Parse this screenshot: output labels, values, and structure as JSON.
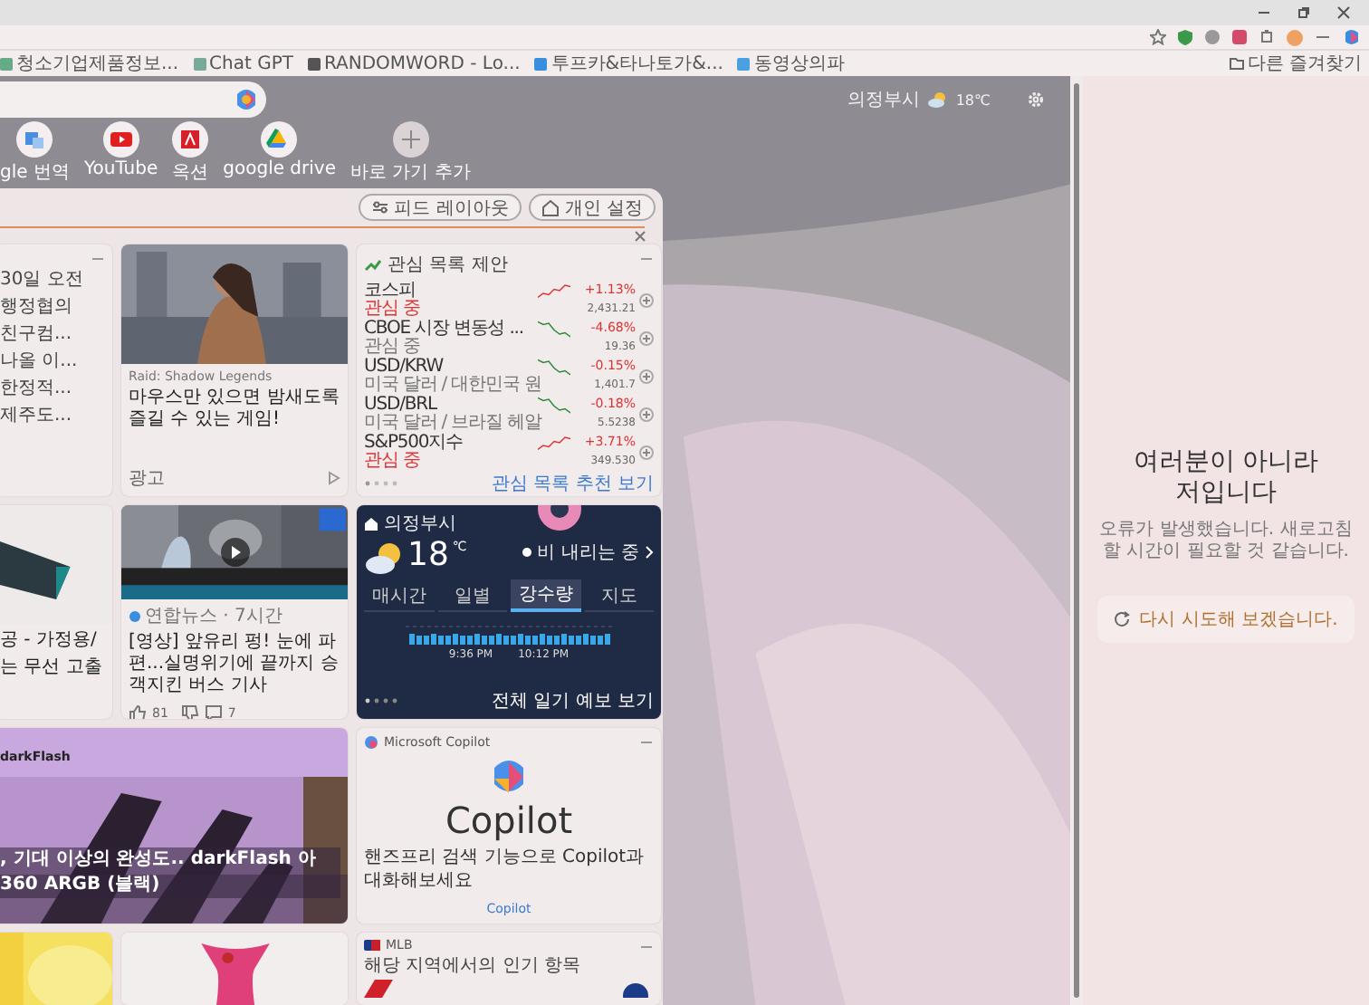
{
  "bookmarks": [
    {
      "label": "청소기업제품정보..."
    },
    {
      "label": "Chat GPT"
    },
    {
      "label": "RANDOMWORD - Lo..."
    },
    {
      "label": "투프카&타나토가&..."
    },
    {
      "label": "동영상의파"
    }
  ],
  "other_favorites": "다른 즐겨찾기",
  "header_weather": {
    "location": "의정부시",
    "temp": "18℃"
  },
  "quick_links": [
    {
      "label": "gle 번역",
      "kind": "translate"
    },
    {
      "label": "YouTube",
      "kind": "youtube"
    },
    {
      "label": "옥션",
      "kind": "auction"
    },
    {
      "label": "google drive",
      "kind": "drive"
    },
    {
      "label": "바로 가기 추가",
      "kind": "add"
    }
  ],
  "feed": {
    "buttons": [
      {
        "label": "피드 레이아웃",
        "kind": "layout"
      },
      {
        "label": "개인 설정",
        "kind": "personalize"
      }
    ],
    "headlines": [
      "30일 오전",
      "행정협의",
      "친구컴...",
      "나올 이...",
      "한정적...",
      "제주도..."
    ],
    "product": {
      "lines": [
        "공 - 가정용/",
        "는 무선 고출"
      ]
    },
    "ad": {
      "source": "Raid: Shadow Legends",
      "title": "마우스만 있으면 밤새도록 즐길 수 있는 게임!",
      "label": "광고"
    },
    "video": {
      "source": "연합뉴스 · 7시간",
      "title": "[영상] 앞유리 펑! 눈에 파편...실명위기에 끝까지 승객지킨 버스 기사",
      "likes": "81",
      "comments": "7"
    },
    "watchlist": {
      "title": "관심 목록 제안",
      "rows": [
        {
          "name": "코스피",
          "sub": "관심 중",
          "change": "+1.13%",
          "value": "2,431.21",
          "up": true
        },
        {
          "name": "CBOE 시장 변동성 ...",
          "sub": "관심 중",
          "change": "-4.68%",
          "value": "19.36",
          "up": false
        },
        {
          "name": "USD/KRW",
          "sub": "미국 달러 / 대한민국 원",
          "change": "-0.15%",
          "value": "1,401.7",
          "up": false
        },
        {
          "name": "USD/BRL",
          "sub": "미국 달러 / 브라질 헤알",
          "change": "-0.18%",
          "value": "5.5238",
          "up": false
        },
        {
          "name": "S&P500지수",
          "sub": "관심 중",
          "change": "+3.71%",
          "value": "349.530",
          "up": true
        }
      ],
      "footer": "관심 목록 추천 보기"
    },
    "weather": {
      "location": "의정부시",
      "temp": "18",
      "unit": "℃",
      "condition": "비 내리는 중",
      "tabs": [
        {
          "label": "매시간",
          "selected": false
        },
        {
          "label": "일별",
          "selected": false
        },
        {
          "label": "강수량",
          "selected": true
        },
        {
          "label": "지도",
          "selected": false
        }
      ],
      "times": [
        "9:36 PM",
        "10:12 PM"
      ],
      "footer": "전체 일기 예보 보기"
    },
    "wide_story": {
      "brand": "darkFlash",
      "lines": [
        ", 기대 이상의 완성도.. darkFlash 아",
        "360 ARGB (블랙)"
      ]
    },
    "copilot": {
      "source": "Microsoft Copilot",
      "logo_text": "Copilot",
      "text": "핸즈프리 검색 기능으로 Copilot과 대화해보세요",
      "link": "Copilot"
    },
    "mlb": {
      "title": "MLB",
      "subtitle": "해당 지역에서의 인기 항목"
    }
  },
  "error_panel": {
    "title": "여러분이 아니라 저입니다",
    "message": "오류가 발생했습니다. 새로고침할 시간이 필요할 것 같습니다.",
    "retry": "다시 시도해 보겠습니다."
  }
}
